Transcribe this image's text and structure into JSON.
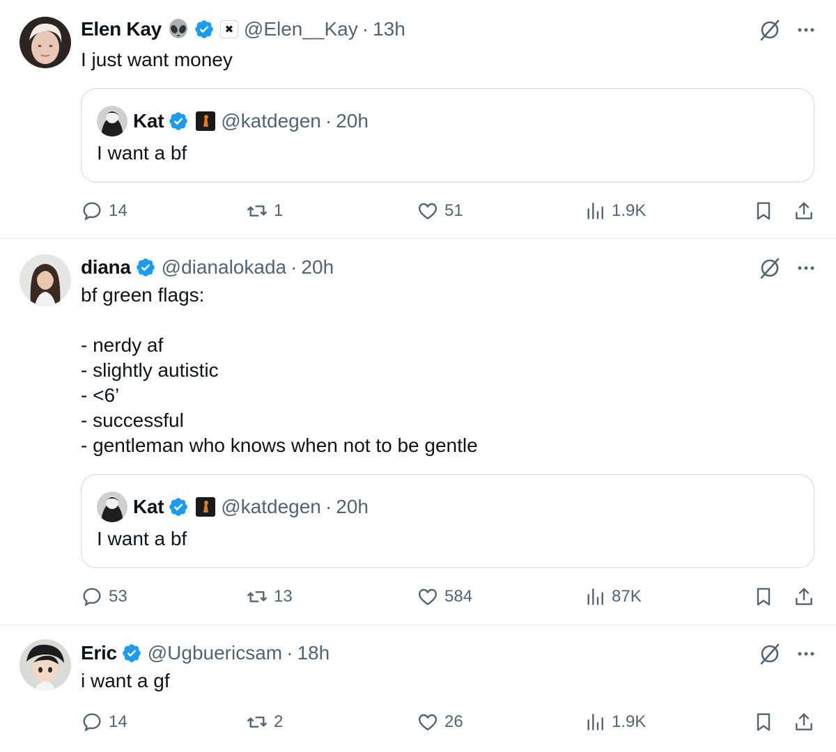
{
  "tweets": [
    {
      "author": {
        "name": "Elen Kay",
        "handle": "@Elen__Kay",
        "time": "13h",
        "verified": true,
        "emoji_badge": "alien-icon",
        "affiliation": "x-logo-icon"
      },
      "text": "I just want money",
      "quote": {
        "name": "Kat",
        "handle": "@katdegen",
        "time": "20h",
        "verified": true,
        "text": "I want a bf"
      },
      "stats": {
        "replies": "14",
        "reposts": "1",
        "likes": "51",
        "views": "1.9K"
      }
    },
    {
      "author": {
        "name": "diana",
        "handle": "@dianalokada",
        "time": "20h",
        "verified": true
      },
      "text": "bf green flags:\n\n- nerdy af\n- slightly autistic\n- <6’\n- successful\n- gentleman who knows when not to be gentle",
      "quote": {
        "name": "Kat",
        "handle": "@katdegen",
        "time": "20h",
        "verified": true,
        "text": "I want a bf"
      },
      "stats": {
        "replies": "53",
        "reposts": "13",
        "likes": "584",
        "views": "87K"
      }
    },
    {
      "author": {
        "name": "Eric",
        "handle": "@Ugbuericsam",
        "time": "18h",
        "verified": true
      },
      "text": "i want a gf",
      "stats": {
        "replies": "14",
        "reposts": "2",
        "likes": "26",
        "views": "1.9K"
      }
    }
  ],
  "separator": "·",
  "colors": {
    "verified": "#1d9bf0",
    "muted": "#536471",
    "border": "#cfd9de",
    "text": "#0f1419"
  }
}
